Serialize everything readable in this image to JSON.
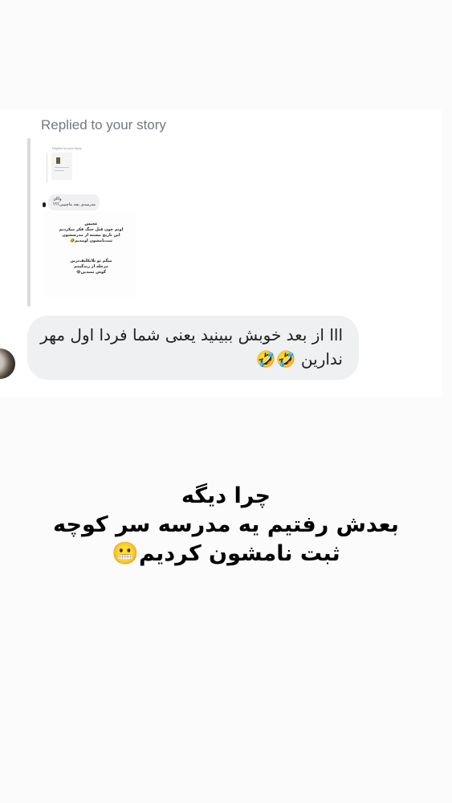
{
  "reply_card": {
    "replied_label": "Replied to your story",
    "message_line1": "ااا از بعد خوبش ببینید یعنی شما فردا اول مهر",
    "message_line2": "ندارین 🤣🤣"
  },
  "quoted_story": {
    "replied_label": "Replied to your story",
    "bubble_line1": "وااای",
    "bubble_line2": "مدرسه‌ی بچه ماچیییی؟؟؟",
    "post_lines": [
      "عجبس",
      "اونم چون قبل جنگ فکر میکردیم",
      "این تاریخ بیسته از مدرسشون",
      "ثبت‌نامشون اومدیم🤣",
      "میگم تو بلاتکلیف‌ترین",
      "مرحله از زندگیمم",
      "گوش نمیدین😂"
    ]
  },
  "story_text": {
    "line1": "چرا دیگه",
    "line2": "بعدش رفتیم یه مدرسه سر کوچه",
    "line3": "ثبت نامشون کردیم😬"
  }
}
